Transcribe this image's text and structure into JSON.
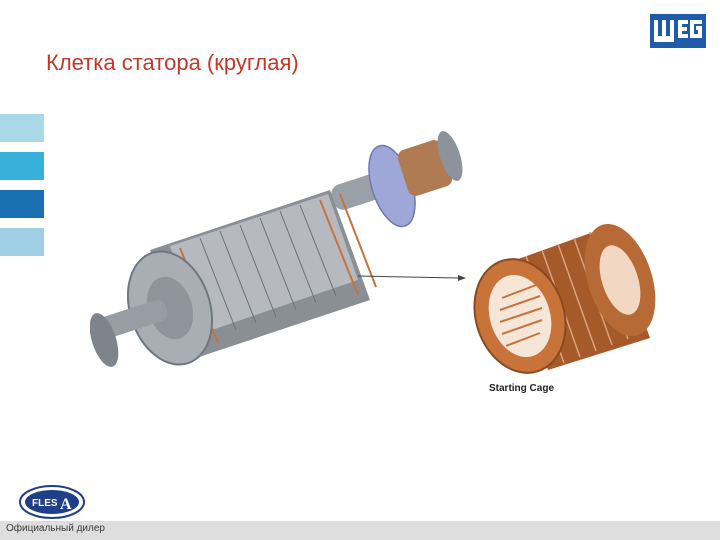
{
  "slide": {
    "title": "Клетка статора (круглая)",
    "caption": "Starting Cage",
    "footer": "Официальный дилер"
  },
  "brand": {
    "logo_text": "WEG",
    "dealer_logo_text": "FLES A"
  },
  "colors": {
    "title": "#c0392b",
    "logo_blue": "#1f5ba8",
    "tab_1": "#a9d8e6",
    "tab_2": "#36b0d8",
    "tab_3": "#1a6fb0",
    "tab_4": "#9ecfe4",
    "copper": "#c8733a",
    "steel": "#9aa0a8"
  }
}
